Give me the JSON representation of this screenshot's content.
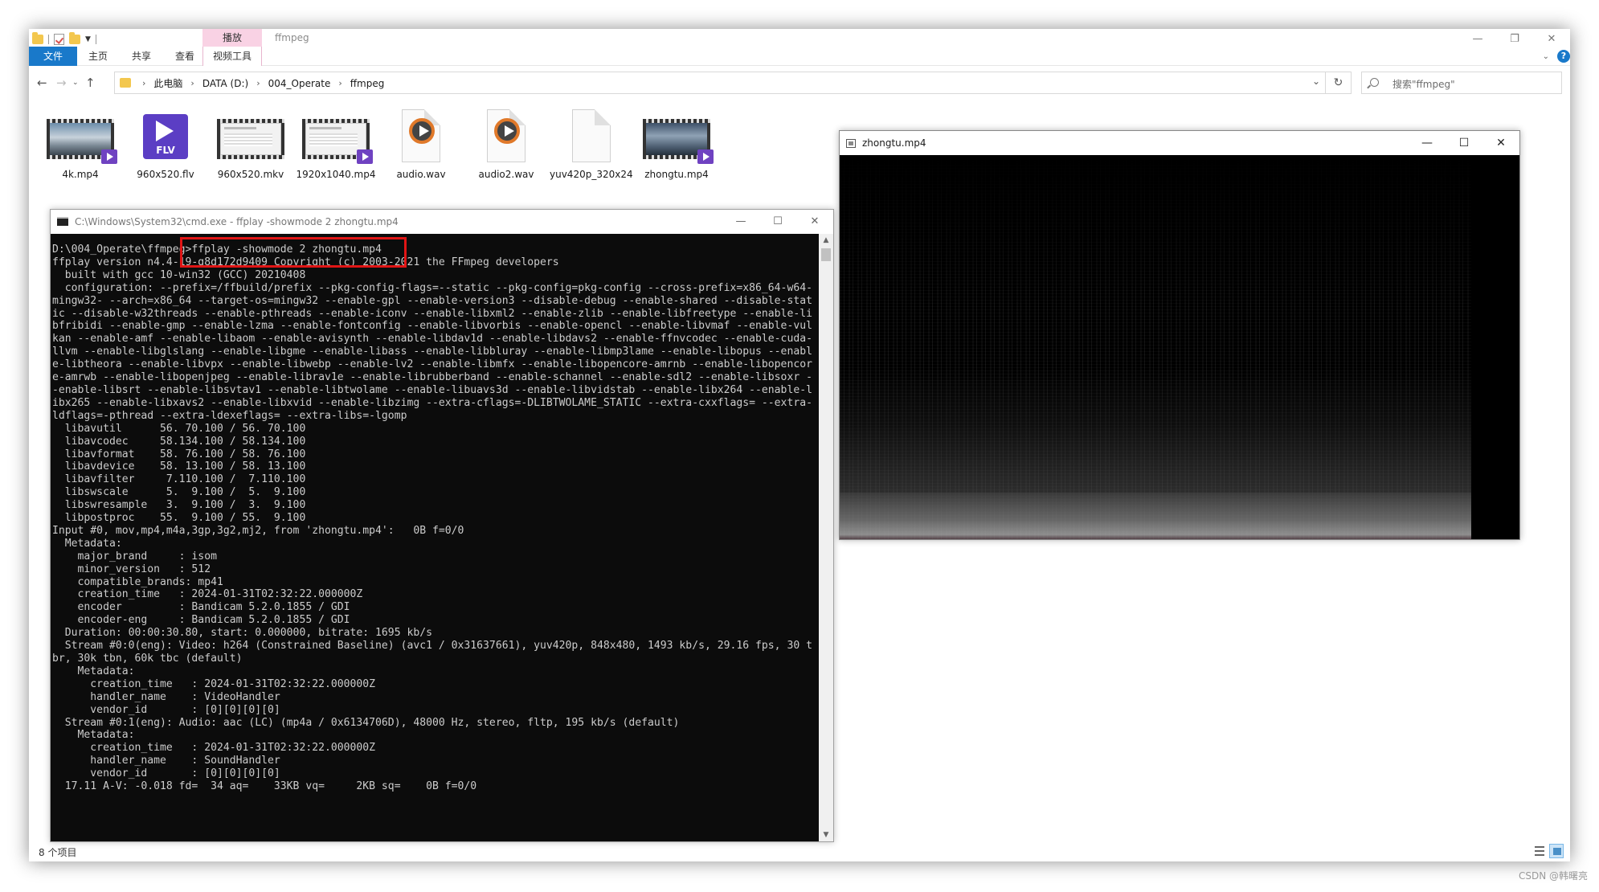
{
  "explorer": {
    "window_title": "ffmpeg",
    "context_tab_group": "播放",
    "window_controls": [
      "—",
      "❐",
      "✕"
    ],
    "ribbon_tabs": {
      "file": "文件",
      "home": "主页",
      "share": "共享",
      "view": "查看",
      "video_tools": "视频工具"
    },
    "address": {
      "breadcrumbs": [
        "此电脑",
        "DATA (D:)",
        "004_Operate",
        "ffmpeg"
      ],
      "search_placeholder": "搜索\"ffmpeg\""
    },
    "files": [
      {
        "name": "4k.mp4",
        "icon": "video-thumbnail-icon"
      },
      {
        "name": "960x520.flv",
        "icon": "flv-file-icon"
      },
      {
        "name": "960x520.mkv",
        "icon": "video-thumbnail-icon"
      },
      {
        "name": "1920x1040.mp4",
        "icon": "video-thumbnail-icon"
      },
      {
        "name": "audio.wav",
        "icon": "audio-file-icon"
      },
      {
        "name": "audio2.wav",
        "icon": "audio-file-icon"
      },
      {
        "name": "yuv420p_320x240.yuv",
        "icon": "blank-file-icon"
      },
      {
        "name": "zhongtu.mp4",
        "icon": "video-thumbnail-icon"
      }
    ],
    "status_text": "8 个项目"
  },
  "cmd": {
    "title": "C:\\Windows\\System32\\cmd.exe - ffplay  -showmode 2 zhongtu.mp4",
    "window_controls": [
      "—",
      "☐",
      "✕"
    ],
    "lines": [
      "D:\\004_Operate\\ffmpeg>ffplay -showmode 2 zhongtu.mp4",
      "ffplay version n4.4-19-g8d172d9409 Copyright (c) 2003-2021 the FFmpeg developers",
      "  built with gcc 10-win32 (GCC) 20210408",
      "  configuration: --prefix=/ffbuild/prefix --pkg-config-flags=--static --pkg-config=pkg-config --cross-prefix=x86_64-w64-",
      "mingw32- --arch=x86_64 --target-os=mingw32 --enable-gpl --enable-version3 --disable-debug --enable-shared --disable-stat",
      "ic --disable-w32threads --enable-pthreads --enable-iconv --enable-libxml2 --enable-zlib --enable-libfreetype --enable-li",
      "bfribidi --enable-gmp --enable-lzma --enable-fontconfig --enable-libvorbis --enable-opencl --enable-libvmaf --enable-vul",
      "kan --enable-amf --enable-libaom --enable-avisynth --enable-libdav1d --enable-libdavs2 --enable-ffnvcodec --enable-cuda-",
      "llvm --enable-libglslang --enable-libgme --enable-libass --enable-libbluray --enable-libmp3lame --enable-libopus --enabl",
      "e-libtheora --enable-libvpx --enable-libwebp --enable-lv2 --enable-libmfx --enable-libopencore-amrnb --enable-libopencor",
      "e-amrwb --enable-libopenjpeg --enable-librav1e --enable-librubberband --enable-schannel --enable-sdl2 --enable-libsoxr -",
      "-enable-libsrt --enable-libsvtav1 --enable-libtwolame --enable-libuavs3d --enable-libvidstab --enable-libx264 --enable-l",
      "ibx265 --enable-libxavs2 --enable-libxvid --enable-libzimg --extra-cflags=-DLIBTWOLAME_STATIC --extra-cxxflags= --extra-",
      "ldflags=-pthread --extra-ldexeflags= --extra-libs=-lgomp",
      "  libavutil      56. 70.100 / 56. 70.100",
      "  libavcodec     58.134.100 / 58.134.100",
      "  libavformat    58. 76.100 / 58. 76.100",
      "  libavdevice    58. 13.100 / 58. 13.100",
      "  libavfilter     7.110.100 /  7.110.100",
      "  libswscale      5.  9.100 /  5.  9.100",
      "  libswresample   3.  9.100 /  3.  9.100",
      "  libpostproc    55.  9.100 / 55.  9.100",
      "Input #0, mov,mp4,m4a,3gp,3g2,mj2, from 'zhongtu.mp4':   0B f=0/0",
      "  Metadata:",
      "    major_brand     : isom",
      "    minor_version   : 512",
      "    compatible_brands: mp41",
      "    creation_time   : 2024-01-31T02:32:22.000000Z",
      "    encoder         : Bandicam 5.2.0.1855 / GDI",
      "    encoder-eng     : Bandicam 5.2.0.1855 / GDI",
      "  Duration: 00:00:30.80, start: 0.000000, bitrate: 1695 kb/s",
      "  Stream #0:0(eng): Video: h264 (Constrained Baseline) (avc1 / 0x31637661), yuv420p, 848x480, 1493 kb/s, 29.16 fps, 30 t",
      "br, 30k tbn, 60k tbc (default)",
      "    Metadata:",
      "      creation_time   : 2024-01-31T02:32:22.000000Z",
      "      handler_name    : VideoHandler",
      "      vendor_id       : [0][0][0][0]",
      "  Stream #0:1(eng): Audio: aac (LC) (mp4a / 0x6134706D), 48000 Hz, stereo, fltp, 195 kb/s (default)",
      "    Metadata:",
      "      creation_time   : 2024-01-31T02:32:22.000000Z",
      "      handler_name    : SoundHandler",
      "      vendor_id       : [0][0][0][0]",
      "  17.11 A-V: -0.018 fd=  34 aq=    33KB vq=     2KB sq=    0B f=0/0"
    ]
  },
  "player": {
    "title": "zhongtu.mp4",
    "window_controls": [
      "—",
      "☐",
      "✕"
    ]
  },
  "watermark": "CSDN @韩曙亮",
  "colors": {
    "accent": "#1979ca",
    "context_tab": "#f9d2e4",
    "console_bg": "#0c0c0c",
    "console_fg": "#cccccc",
    "annotation_red": "#e01515"
  }
}
